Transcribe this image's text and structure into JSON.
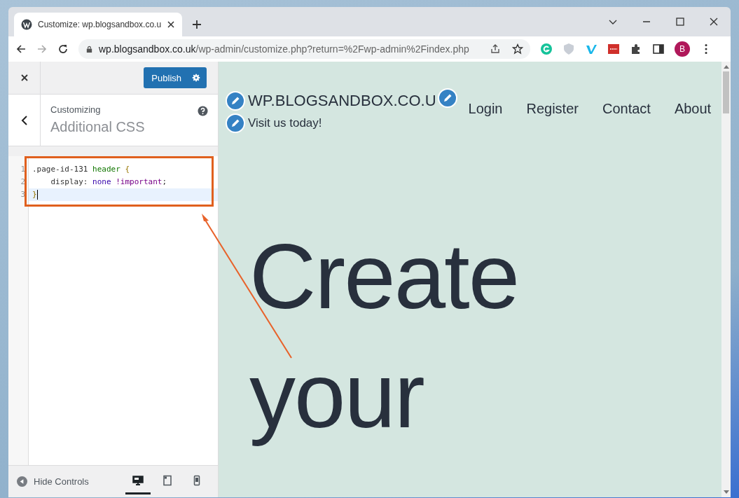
{
  "browser": {
    "tab_title": "Customize: wp.blogsandbox.co.u",
    "url_host": "wp.blogsandbox.co.uk",
    "url_path": "/wp-admin/customize.php?return=%2Fwp-admin%2Findex.php",
    "profile_initial": "B"
  },
  "customizer": {
    "publish_label": "Publish",
    "section_label": "Customizing",
    "section_title": "Additional CSS",
    "code_lines": [
      {
        "number": "1",
        "current": false,
        "tokens": [
          {
            "kind": "selector",
            "text": ".page-id-131 "
          },
          {
            "kind": "tag",
            "text": "header "
          },
          {
            "kind": "brace",
            "text": "{"
          }
        ]
      },
      {
        "number": "2",
        "current": false,
        "tokens": [
          {
            "kind": "plain",
            "text": "    display: "
          },
          {
            "kind": "value",
            "text": "none "
          },
          {
            "kind": "keyword",
            "text": "!important"
          },
          {
            "kind": "plain",
            "text": ";"
          }
        ]
      },
      {
        "number": "3",
        "current": true,
        "tokens": [
          {
            "kind": "brace",
            "text": "}"
          }
        ]
      }
    ],
    "hide_controls_label": "Hide Controls",
    "devices": [
      {
        "kind": "desktop",
        "selected": true
      },
      {
        "kind": "tablet",
        "selected": false
      },
      {
        "kind": "mobile",
        "selected": false
      }
    ]
  },
  "preview": {
    "site_title": "WP.BLOGSANDBOX.CO.U",
    "tagline": "Visit us today!",
    "nav": [
      "Login",
      "Register",
      "Contact",
      "About"
    ],
    "hero_lines": [
      "Create",
      "your"
    ]
  }
}
